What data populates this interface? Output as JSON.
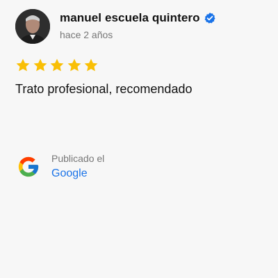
{
  "review": {
    "author": "manuel escuela quintero",
    "verified_icon": "verified-badge-icon",
    "time_ago": "hace 2 años",
    "rating": 5,
    "rating_max": 5,
    "star_color": "#f9bf05",
    "text": "Trato profesional, recomendado"
  },
  "source": {
    "posted_label": "Publicado el",
    "platform": "Google",
    "platform_icon": "google-logo-icon",
    "link_color": "#1a73e8"
  }
}
